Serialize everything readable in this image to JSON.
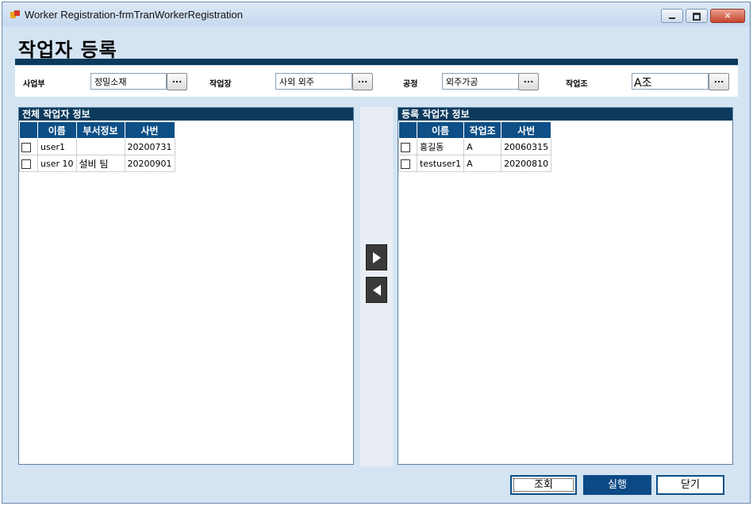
{
  "window": {
    "title": "Worker Registration-frmTranWorkerRegistration"
  },
  "page": {
    "title": "작업자 등록"
  },
  "filters": {
    "business": {
      "label": "사업부",
      "value": "정밀소재",
      "button": "..."
    },
    "workplace": {
      "label": "작업장",
      "value": "사외 외주",
      "button": "..."
    },
    "process": {
      "label": "공정",
      "value": "외주가공",
      "button": "..."
    },
    "team": {
      "label": "작업조",
      "value": "A조",
      "button": "..."
    }
  },
  "left_panel": {
    "header": "전체 작업자 정보",
    "columns": [
      "이름",
      "부서정보",
      "사번"
    ],
    "rows": [
      {
        "name": "user1",
        "dept": "",
        "id": "20200731"
      },
      {
        "name": "user 10",
        "dept": "설비 팀",
        "id": "20200901"
      }
    ]
  },
  "right_panel": {
    "header": "등록 작업자 정보",
    "columns": [
      "이름",
      "작업조",
      "사번"
    ],
    "rows": [
      {
        "name": "홍길동",
        "team": "A",
        "id": "20060315"
      },
      {
        "name": "testuser1",
        "team": "A",
        "id": "20200810"
      }
    ]
  },
  "buttons": {
    "search": "조회",
    "execute": "실행",
    "close": "닫기"
  },
  "icons": {
    "app": "app-icon",
    "move_right": "arrow-right-icon",
    "move_left": "arrow-left-icon"
  },
  "colors": {
    "accent": "#0b3a5c",
    "header_blue": "#0d4f86",
    "window_bg": "#d4e4f3"
  }
}
